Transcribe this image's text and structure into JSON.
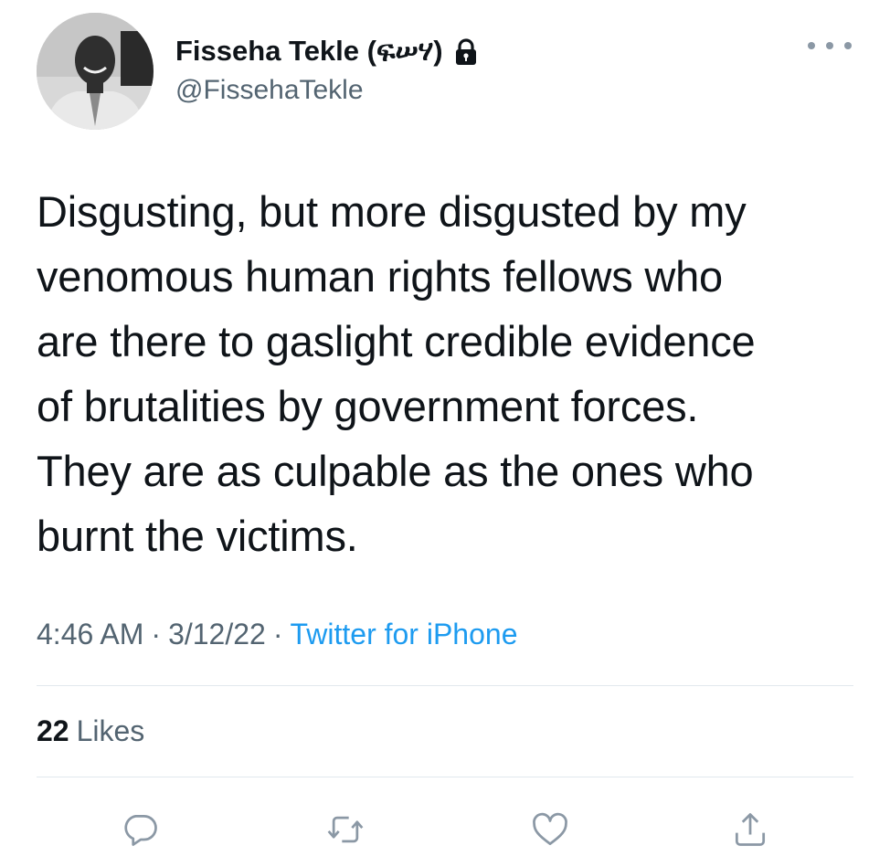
{
  "author": {
    "display_name": "Fisseha Tekle (ፍሠሃ)",
    "handle": "@FissehaTekle",
    "protected": true
  },
  "tweet": {
    "lines": [
      "Disgusting, but more disgusted by my",
      "venomous human rights fellows who",
      "are there to gaslight credible evidence",
      "of brutalities by government forces.",
      "They are as culpable as the ones who",
      "burnt the victims."
    ],
    "time": "4:46 AM",
    "date": "3/12/22",
    "separator": "·",
    "source": "Twitter for iPhone"
  },
  "stats": {
    "likes_count": "22",
    "likes_label": "Likes"
  },
  "colors": {
    "text": "#0f1419",
    "secondary": "#536471",
    "accent": "#1d9bf0",
    "divider": "#e1e8ed",
    "icon": "#8b98a5"
  },
  "icons": {
    "lock": "lock-icon",
    "more": "more-icon",
    "reply": "reply-icon",
    "retweet": "retweet-icon",
    "like": "heart-icon",
    "share": "share-icon"
  }
}
